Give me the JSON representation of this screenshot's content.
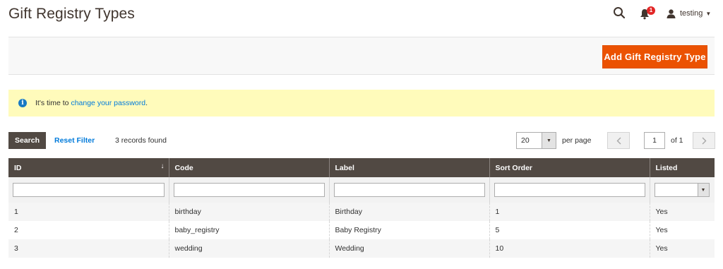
{
  "page": {
    "title": "Gift Registry Types"
  },
  "header": {
    "notifications_count": "1",
    "user_name": "testing"
  },
  "actions": {
    "add_button": "Add Gift Registry Type"
  },
  "message": {
    "prefix": "It's time to ",
    "link": "change your password",
    "suffix": "."
  },
  "toolbar": {
    "search_label": "Search",
    "reset_label": "Reset Filter",
    "records_found": "3 records found",
    "per_page_value": "20",
    "per_page_label": "per page",
    "current_page": "1",
    "of_pages": "of 1"
  },
  "grid": {
    "columns": [
      "ID",
      "Code",
      "Label",
      "Sort Order",
      "Listed"
    ],
    "rows": [
      [
        "1",
        "birthday",
        "Birthday",
        "1",
        "Yes"
      ],
      [
        "2",
        "baby_registry",
        "Baby Registry",
        "5",
        "Yes"
      ],
      [
        "3",
        "wedding",
        "Wedding",
        "10",
        "Yes"
      ]
    ]
  },
  "colors": {
    "accent": "#eb5202",
    "header_bg": "#514943",
    "message_bg": "#fffbbb",
    "link": "#007bdb"
  }
}
